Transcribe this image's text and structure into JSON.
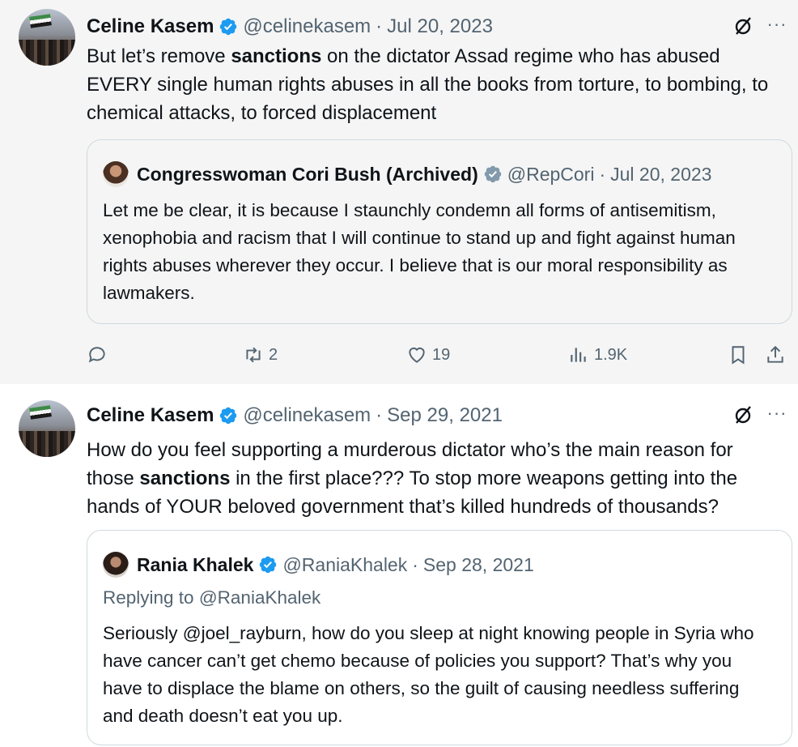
{
  "tweet1": {
    "author_name": "Celine Kasem",
    "author_handle": "@celinekasem",
    "separator": "·",
    "date": "Jul 20, 2023",
    "more": "···",
    "text_part1": "But let’s remove ",
    "text_bold": "sanctions",
    "text_part2": " on the dictator Assad regime who has abused EVERY single human rights abuses in all the books from torture, to bombing, to chemical attacks, to forced displacement",
    "quote": {
      "author_name": "Congresswoman Cori Bush (Archived)",
      "author_handle": "@RepCori",
      "separator": "·",
      "date": "Jul 20, 2023",
      "text": "Let me be clear, it is because I staunchly condemn all forms of antisemitism, xenophobia and racism that I will continue to stand up and fight against human rights abuses wherever they occur. I believe that is our moral responsibility as lawmakers."
    },
    "actions": {
      "reply_icon": "reply-icon",
      "retweets": "2",
      "likes": "19",
      "views": "1.9K",
      "bookmark_icon": "bookmark-icon",
      "share_icon": "share-icon"
    }
  },
  "tweet2": {
    "author_name": "Celine Kasem",
    "author_handle": "@celinekasem",
    "separator": "·",
    "date": "Sep 29, 2021",
    "more": "···",
    "text_part1": "How do you feel supporting a murderous dictator who’s the main reason for those ",
    "text_bold": "sanctions",
    "text_part2": " in the first place??? To stop more weapons getting into the hands of YOUR beloved government that’s killed hundreds of thousands?",
    "quote": {
      "author_name": "Rania Khalek",
      "author_handle": "@RaniaKhalek",
      "separator": "·",
      "date": "Sep 28, 2021",
      "replying_to_label": "Replying to ",
      "replying_to_handle": "@RaniaKhalek",
      "text": "Seriously @joel_rayburn, how do you sleep at night knowing people in Syria who have cancer can’t get chemo because of policies you support? That’s why you have to displace the blame on others, so the guilt of causing needless suffering and death doesn’t eat you up."
    }
  },
  "colors": {
    "verified_blue": "#1d9bf0",
    "gray_text": "#536471",
    "border": "#cfd9de"
  }
}
